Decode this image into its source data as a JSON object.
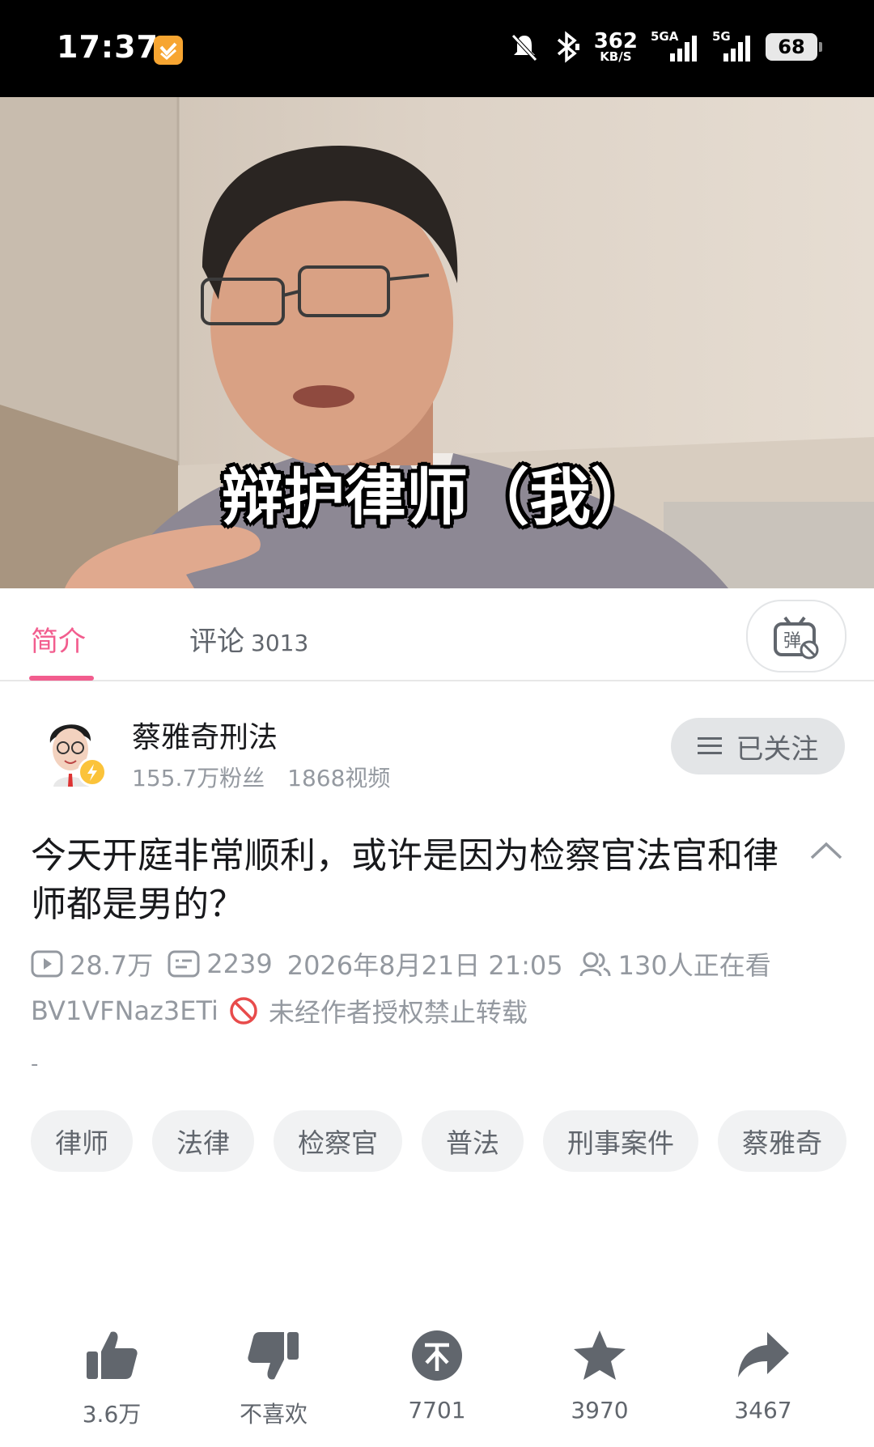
{
  "status_bar": {
    "time": "17:37",
    "net_speed_value": "362",
    "net_speed_unit": "KB/S",
    "network_1": "5GA",
    "network_2": "5G",
    "battery": "68"
  },
  "video": {
    "caption": "辩护律师（我）"
  },
  "tabs": {
    "intro": "简介",
    "comments": "评论",
    "comments_count": "3013"
  },
  "uploader": {
    "name": "蔡雅奇刑法",
    "followers": "155.7万粉丝",
    "videos": "1868视频",
    "follow_label": "已关注"
  },
  "title": "今天开庭非常顺利，或许是因为检察官法官和律师都是男的？",
  "meta": {
    "views": "28.7万",
    "danmaku": "2239",
    "datetime": "2026年8月21日 21:05",
    "watching": "130人正在看",
    "bvid": "BV1VFNaz3ETi",
    "copyright": "未经作者授权禁止转载",
    "description": "-"
  },
  "tags": [
    "律师",
    "法律",
    "检察官",
    "普法",
    "刑事案件",
    "蔡雅奇"
  ],
  "actions": {
    "like": "3.6万",
    "dislike": "不喜欢",
    "coin": "7701",
    "favorite": "3970",
    "share": "3467"
  },
  "colors": {
    "accent_pink": "#f25d8e",
    "icon_gray": "#61666d",
    "meta_gray": "#9499a0"
  }
}
